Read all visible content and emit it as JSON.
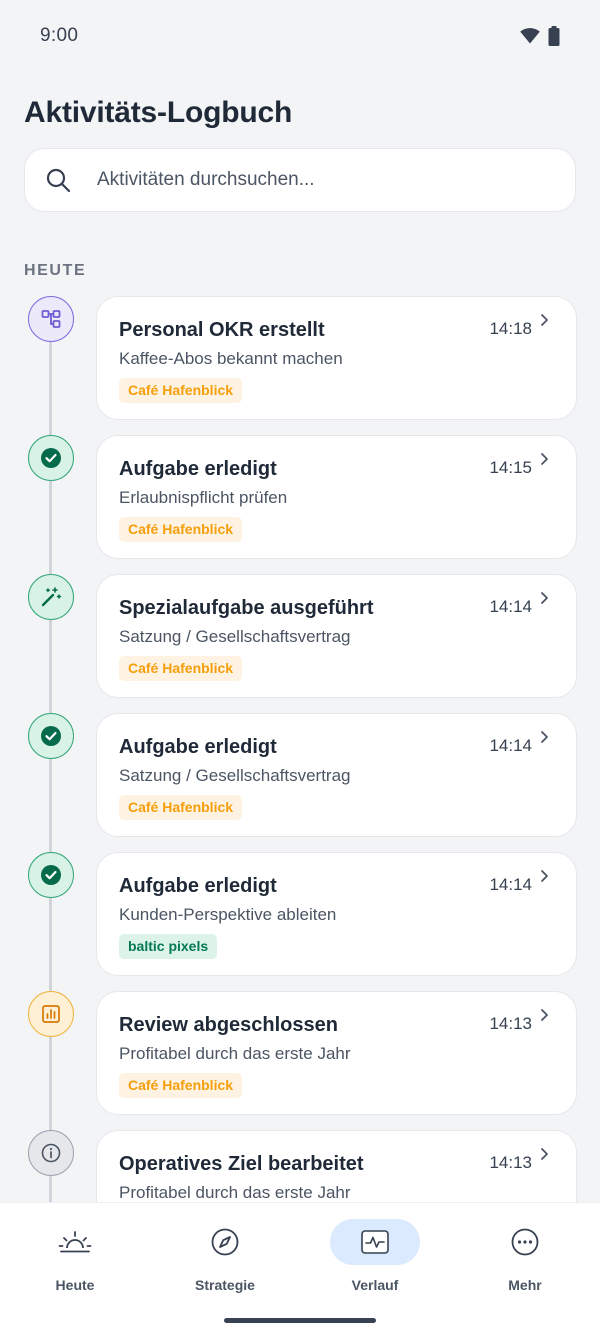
{
  "status_bar": {
    "time": "9:00"
  },
  "page": {
    "title": "Aktivitäts-Logbuch"
  },
  "search": {
    "placeholder": "Aktivitäten durchsuchen..."
  },
  "section": {
    "label": "HEUTE"
  },
  "entries": [
    {
      "icon": "hierarchy-icon",
      "title": "Personal OKR erstellt",
      "subtitle": "Kaffee-Abos bekannt machen",
      "time": "14:18",
      "tag": "Café Hafenblick",
      "tag_color": "#f59e0b"
    },
    {
      "icon": "check-circle-icon",
      "title": "Aufgabe erledigt",
      "subtitle": "Erlaubnispflicht prüfen",
      "time": "14:15",
      "tag": "Café Hafenblick",
      "tag_color": "#f59e0b"
    },
    {
      "icon": "magic-wand-icon",
      "title": "Spezialaufgabe ausgeführt",
      "subtitle": "Satzung / Gesellschaftsvertrag",
      "time": "14:14",
      "tag": "Café Hafenblick",
      "tag_color": "#f59e0b"
    },
    {
      "icon": "check-circle-icon",
      "title": "Aufgabe erledigt",
      "subtitle": "Satzung / Gesellschaftsvertrag",
      "time": "14:14",
      "tag": "Café Hafenblick",
      "tag_color": "#f59e0b"
    },
    {
      "icon": "check-circle-icon",
      "title": "Aufgabe erledigt",
      "subtitle": "Kunden-Perspektive ableiten",
      "time": "14:14",
      "tag": "baltic pixels",
      "tag_color": "#059669"
    },
    {
      "icon": "bar-chart-icon",
      "title": "Review abgeschlossen",
      "subtitle": "Profitabel durch das erste Jahr",
      "time": "14:13",
      "tag": "Café Hafenblick",
      "tag_color": "#f59e0b"
    },
    {
      "icon": "info-icon",
      "title": "Operatives Ziel bearbeitet",
      "subtitle": "Profitabel durch das erste Jahr",
      "time": "14:13",
      "tag": "",
      "tag_color": ""
    }
  ],
  "nav": [
    {
      "label": "Heute",
      "icon": "sunrise-icon",
      "active": false
    },
    {
      "label": "Strategie",
      "icon": "compass-icon",
      "active": false
    },
    {
      "label": "Verlauf",
      "icon": "activity-icon",
      "active": true
    },
    {
      "label": "Mehr",
      "icon": "more-icon",
      "active": false
    }
  ],
  "colors": {
    "background": "#f3f4f6",
    "accent": "#3b82f6",
    "success": "#059669",
    "warning": "#f59e0b",
    "purple": "#6d5dd3"
  }
}
